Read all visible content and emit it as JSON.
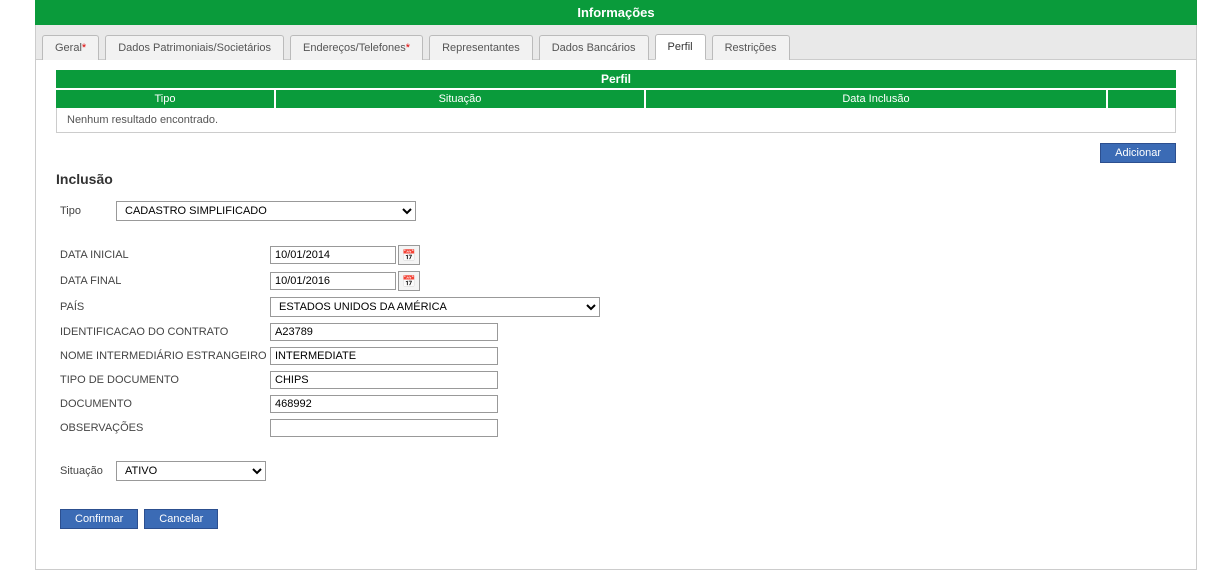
{
  "header": {
    "title": "Informações"
  },
  "tabs": [
    {
      "label": "Geral",
      "required": true
    },
    {
      "label": "Dados Patrimoniais/Societários",
      "required": false
    },
    {
      "label": "Endereços/Telefones",
      "required": true
    },
    {
      "label": "Representantes",
      "required": false
    },
    {
      "label": "Dados Bancários",
      "required": false
    },
    {
      "label": "Perfil",
      "required": false,
      "active": true
    },
    {
      "label": "Restrições",
      "required": false
    }
  ],
  "subHeader": "Perfil",
  "table": {
    "columns": {
      "tipo": "Tipo",
      "situacao": "Situação",
      "data": "Data Inclusão"
    },
    "empty": "Nenhum resultado encontrado."
  },
  "buttons": {
    "adicionar": "Adicionar",
    "confirmar": "Confirmar",
    "cancelar": "Cancelar"
  },
  "section": {
    "title": "Inclusão"
  },
  "form": {
    "labels": {
      "tipo": "Tipo",
      "dataInicial": "DATA INICIAL",
      "dataFinal": "DATA FINAL",
      "pais": "PAÍS",
      "identContrato": "IDENTIFICACAO DO CONTRATO",
      "nomeInterm": "NOME INTERMEDIÁRIO ESTRANGEIRO",
      "tipoDoc": "TIPO DE DOCUMENTO",
      "documento": "DOCUMENTO",
      "observacoes": "OBSERVAÇÕES",
      "situacao": "Situação"
    },
    "values": {
      "tipo": "CADASTRO SIMPLIFICADO",
      "dataInicial": "10/01/2014",
      "dataFinal": "10/01/2016",
      "pais": "ESTADOS UNIDOS DA AMÉRICA",
      "identContrato": "A23789",
      "nomeInterm": "INTERMEDIATE",
      "tipoDoc": "CHIPS",
      "documento": "468992",
      "observacoes": "",
      "situacao": "ATIVO"
    }
  },
  "icons": {
    "calendar": "📅"
  }
}
